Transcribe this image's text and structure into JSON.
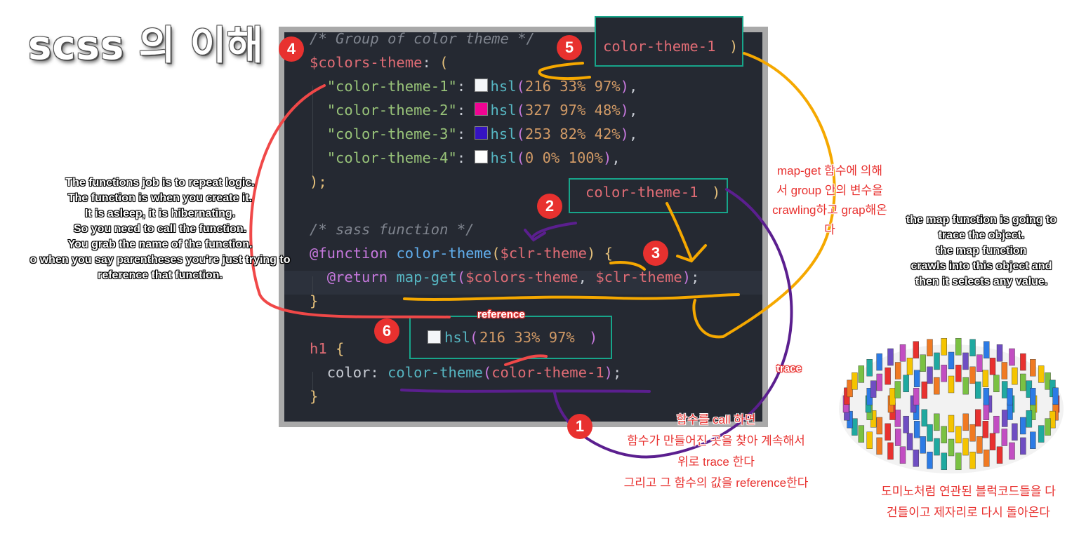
{
  "title": "scss 의 이해",
  "code": {
    "comment1": "/* Group of color theme */",
    "map_var": "$colors-theme",
    "colon_paren": ": (",
    "entries": [
      {
        "key": "\"color-theme-1\"",
        "fn": "hsl",
        "args": "216 33% 97%",
        "swatch": "#f4f6f9"
      },
      {
        "key": "\"color-theme-2\"",
        "fn": "hsl",
        "args": "327 97% 48%",
        "swatch": "#f00493"
      },
      {
        "key": "\"color-theme-3\"",
        "fn": "hsl",
        "args": "253 82% 42%",
        "swatch": "#3513c3"
      },
      {
        "key": "\"color-theme-4\"",
        "fn": "hsl",
        "args": "0 0% 100%",
        "swatch": "#ffffff"
      }
    ],
    "close_map": ");",
    "comment2": "/* sass function */",
    "function_kw": "@function",
    "function_name": "color-theme",
    "function_param": "$clr-theme",
    "function_open": "{",
    "return_kw": "@return",
    "map_get": "map-get",
    "return_args_a": "$colors",
    "return_args_b": "-theme",
    "return_args_c": "$clr-theme",
    "close_fn": "}",
    "selector": "h1",
    "selector_open": "{",
    "property": "color",
    "call_fn": "color-theme",
    "call_arg": "color-theme-1",
    "close_sel": "}"
  },
  "boxes": {
    "box5": "color-theme-1",
    "box2": "color-theme-1",
    "box6_fn": "hsl",
    "box6_args": "216 33% 97%"
  },
  "badges": [
    "1",
    "2",
    "3",
    "4",
    "5",
    "6"
  ],
  "labels": {
    "reference": "reference",
    "trace": "trace"
  },
  "notes": {
    "left_lines": [
      "The functions job is to repeat logic.",
      "The function is when you create it.",
      "It is asleep, it is hibernating.",
      "So you need to call the function.",
      "You grab the name of the function.",
      "o when you say parentheses you're just trying to",
      "reference that function."
    ],
    "right_lines": [
      "the map function is going to",
      "trace the object.",
      "the map function",
      "crawls into this object and",
      "then it selects any value."
    ],
    "korean_mapget": [
      "map-get 함수에 의해",
      "서 group 안의 변수을",
      "crawling하고 grap해온",
      "다"
    ],
    "korean_call": [
      "함수를 call 하면",
      "함수가 만들어진 곳을 찾아 계속해서",
      "위로 trace 한다",
      "그리고 그 함수의 값을 reference한다"
    ],
    "korean_domino": [
      "도미노처럼 연관된 블럭코드들을 다",
      "건들이고 제자리로 다시 돌아온다"
    ]
  },
  "colors": {
    "editor_bg": "#252932",
    "box_border": "#17a58a",
    "badge": "#e8312f",
    "orange_line": "#f5a800",
    "purple_line": "#5b1f8f",
    "red_line": "#f04848"
  }
}
